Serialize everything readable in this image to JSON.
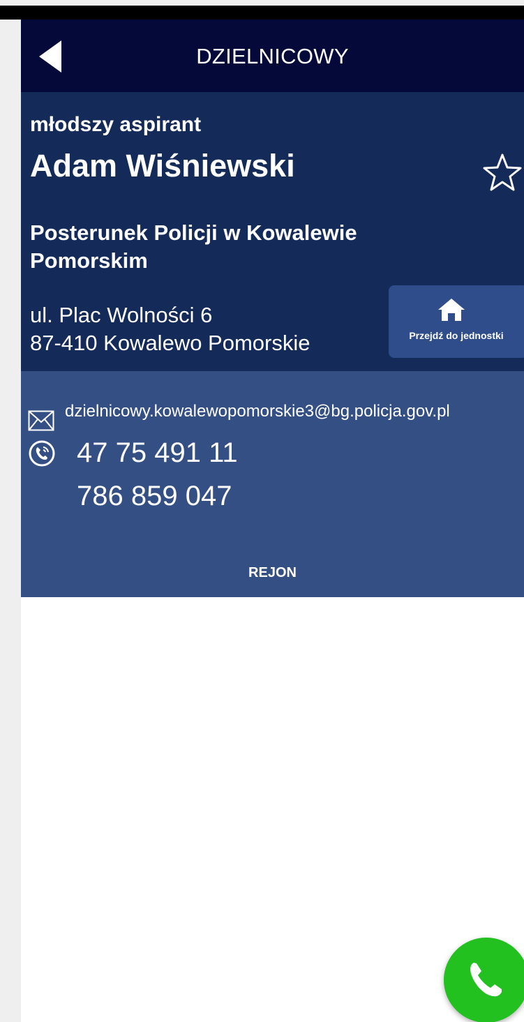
{
  "app": {
    "title": "DZIELNICOWY"
  },
  "officer": {
    "rank": "młodszy aspirant",
    "name": "Adam Wiśniewski"
  },
  "unit": {
    "name": "Posterunek Policji w Kowalewie Pomorskim",
    "address_line1": "ul. Plac Wolności 6",
    "address_line2": "87-410 Kowalewo Pomorskie",
    "goto_label": "Przejdź do jednostki"
  },
  "contact": {
    "email": "dzielnicowy.kowalewopomorskie3@bg.policja.gov.pl",
    "phone1": "47 75 491 11",
    "phone2": "786 859 047",
    "rejon_label": "REJON"
  },
  "icons": {
    "back": "back-arrow-icon",
    "favorite": "star-outline-icon",
    "home": "home-icon",
    "mail": "mail-icon",
    "phone": "phone-icon",
    "call": "call-icon"
  },
  "colors": {
    "appbar": "#05093a",
    "info_panel": "#142a59",
    "contact_panel": "#344f84",
    "button": "#2f4d8a",
    "call_fab": "#22c11f"
  }
}
